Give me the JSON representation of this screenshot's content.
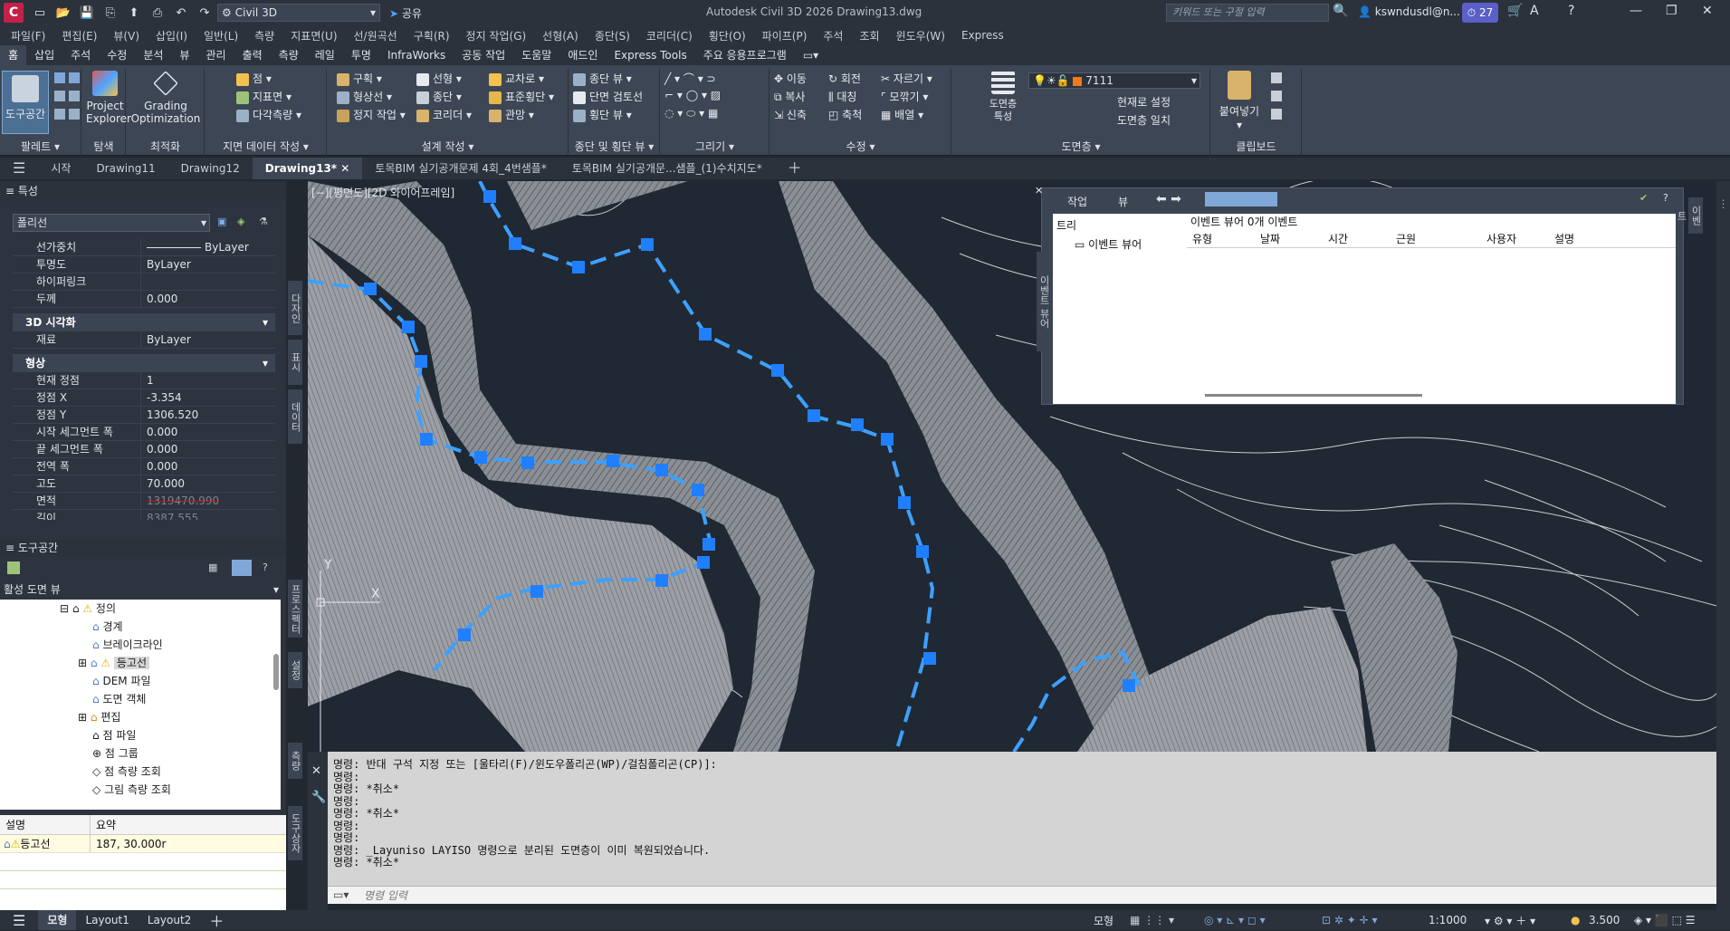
{
  "app": {
    "icon_letter": "C",
    "workspace": "Civil 3D",
    "share": "공유",
    "title": "Autodesk Civil 3D 2026   Drawing13.dwg",
    "search_placeholder": "키워드 또는 구절 입력",
    "user": "kswndusdl@n...",
    "notif_count": "27"
  },
  "menu": [
    "파일(F)",
    "편집(E)",
    "뷰(V)",
    "삽입(I)",
    "일반(L)",
    "측량",
    "지표면(U)",
    "선/원곡선",
    "구획(R)",
    "정지 작업(G)",
    "선형(A)",
    "종단(S)",
    "코리더(C)",
    "횡단(O)",
    "파이프(P)",
    "주석",
    "조회",
    "윈도우(W)",
    "Express"
  ],
  "ribbon_tabs": [
    "홈",
    "삽입",
    "주석",
    "수정",
    "분석",
    "뷰",
    "관리",
    "출력",
    "측량",
    "레일",
    "투명",
    "InfraWorks",
    "공동 작업",
    "도움말",
    "애드인",
    "Express Tools",
    "주요 응용프로그램"
  ],
  "ribbon": {
    "palettes": {
      "title": "팔레트",
      "tool": "도구공간"
    },
    "explore": {
      "title": "탐색",
      "btn": "Project\nExplorer"
    },
    "optim": {
      "title": "최적화",
      "btn": "Grading\nOptimization"
    },
    "ground": {
      "title": "지면 데이터 작성",
      "items": [
        "점",
        "지표면",
        "다각측량"
      ]
    },
    "design": {
      "title": "설계 작성",
      "items": [
        "구획",
        "형상선",
        "정지 작업",
        "선형",
        "종단",
        "코리더",
        "교차로",
        "표준횡단",
        "관망"
      ]
    },
    "profile": {
      "title": "종단 및 횡단 뷰",
      "items": [
        "종단 뷰",
        "단면 검토선",
        "횡단 뷰"
      ]
    },
    "draw": {
      "title": "그리기"
    },
    "modify": {
      "title": "수정",
      "items": [
        "이동",
        "회전",
        "자르기",
        "복사",
        "대칭",
        "모깎기",
        "신축",
        "축척",
        "배열"
      ]
    },
    "layers": {
      "title": "도면층",
      "props": "도면층 특성",
      "layer": "7111",
      "items": [
        "현재로 설정",
        "도면층 일치"
      ]
    },
    "clip": {
      "title": "클립보드",
      "paste": "붙여넣기"
    }
  },
  "doc_tabs": [
    "시작",
    "Drawing11",
    "Drawing12",
    "Drawing13*",
    "토목BIM 실기공개문제 4회_4번샘플*",
    "토목BIM 실기공개문...샘플_(1)수치지도*"
  ],
  "properties": {
    "header": "특성",
    "object": "폴리선",
    "rows_a": [
      {
        "k": "선가중치",
        "v": "ByLayer"
      },
      {
        "k": "투명도",
        "v": "ByLayer"
      },
      {
        "k": "하이퍼링크",
        "v": ""
      },
      {
        "k": "두께",
        "v": "0.000"
      }
    ],
    "sec_3d": "3D 시각화",
    "rows_b": [
      {
        "k": "재료",
        "v": "ByLayer"
      }
    ],
    "sec_geom": "형상",
    "rows_c": [
      {
        "k": "현재 정점",
        "v": "1"
      },
      {
        "k": "정점 X",
        "v": "-3.354"
      },
      {
        "k": "정점 Y",
        "v": "1306.520"
      },
      {
        "k": "시작 세그먼트 폭",
        "v": "0.000"
      },
      {
        "k": "끝 세그먼트 폭",
        "v": "0.000"
      },
      {
        "k": "전역 폭",
        "v": "0.000"
      },
      {
        "k": "고도",
        "v": "70.000"
      },
      {
        "k": "면적",
        "v": "1319470.990"
      },
      {
        "k": "길이",
        "v": "8387.555"
      }
    ],
    "side_tabs": [
      "다자인",
      "표시",
      "데이터"
    ]
  },
  "toolspace": {
    "header": "도구공간",
    "view": "활성 도면 뷰",
    "tree": [
      "정의",
      "경계",
      "브레이크라인",
      "등고선",
      "DEM 파일",
      "도면 객체",
      "편집",
      "점 파일",
      "점 그룹",
      "점 측량 조회",
      "그림 측량 조회"
    ],
    "side_tabs": [
      "프로스펙터",
      "설정",
      "측량",
      "도구상자"
    ],
    "list_headers": [
      "설명",
      "요약"
    ],
    "list_row": {
      "name": "등고선",
      "summary": "187, 30.000r"
    }
  },
  "viewport": {
    "label": "[−][평면도][2D 와이어프레임]",
    "ucs_y": "Y",
    "ucs_x": "X"
  },
  "event_panel": {
    "tabs": [
      "작업",
      "뷰"
    ],
    "tree_label": "트리",
    "tree_item": "이벤트 뷰어",
    "title": "이벤트 뷰어",
    "count": "0개 이벤트",
    "cols": [
      "유형",
      "날짜",
      "시간",
      "근원",
      "사용자",
      "설명"
    ],
    "side_label": "이벤트 뷰어",
    "side_right": "이벤트"
  },
  "command": {
    "lines": [
      "명령: 반대 구석 지정 또는 [울타리(F)/윈도우폴리곤(WP)/걸침폴리곤(CP)]:",
      "명령:",
      "명령: *취소*",
      "명령:",
      "명령: *취소*",
      "명령:",
      "명령:",
      "명령: _Layuniso LAYISO 명령으로 분리된 도면층이 이미 복원되었습니다.",
      "명령: *취소*"
    ],
    "placeholder": "명령 입력"
  },
  "status": {
    "tabs": [
      "모형",
      "Layout1",
      "Layout2"
    ],
    "model": "모형",
    "scale": "1:1000",
    "value": "3.500"
  }
}
